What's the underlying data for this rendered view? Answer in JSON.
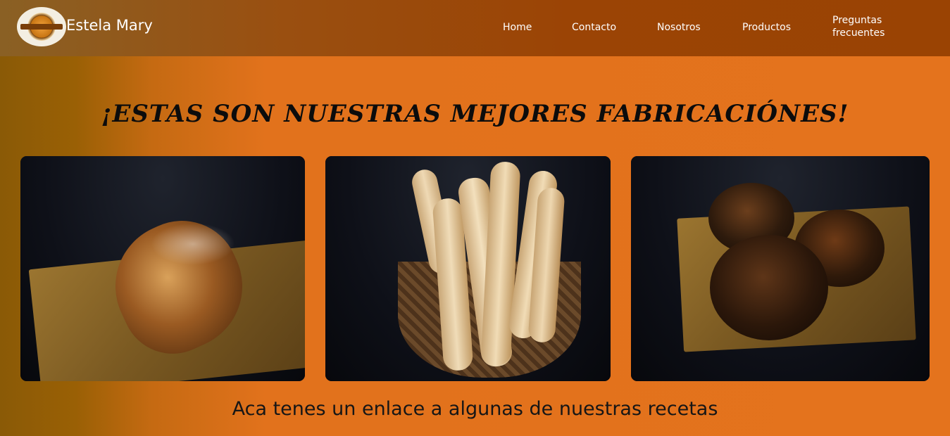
{
  "header": {
    "brand": "Estela Mary",
    "nav": [
      {
        "label": "Home"
      },
      {
        "label": "Contacto"
      },
      {
        "label": "Nosotros"
      },
      {
        "label": "Productos"
      },
      {
        "label": "Preguntas frecuentes"
      }
    ]
  },
  "main": {
    "title": "¡Estas son nuestras mejores fabricaciónes!",
    "caption": "Aca tenes un enlace a algunas de nuestras recetas"
  },
  "colors": {
    "accent": "#e4731d",
    "header": "#9a4303"
  }
}
